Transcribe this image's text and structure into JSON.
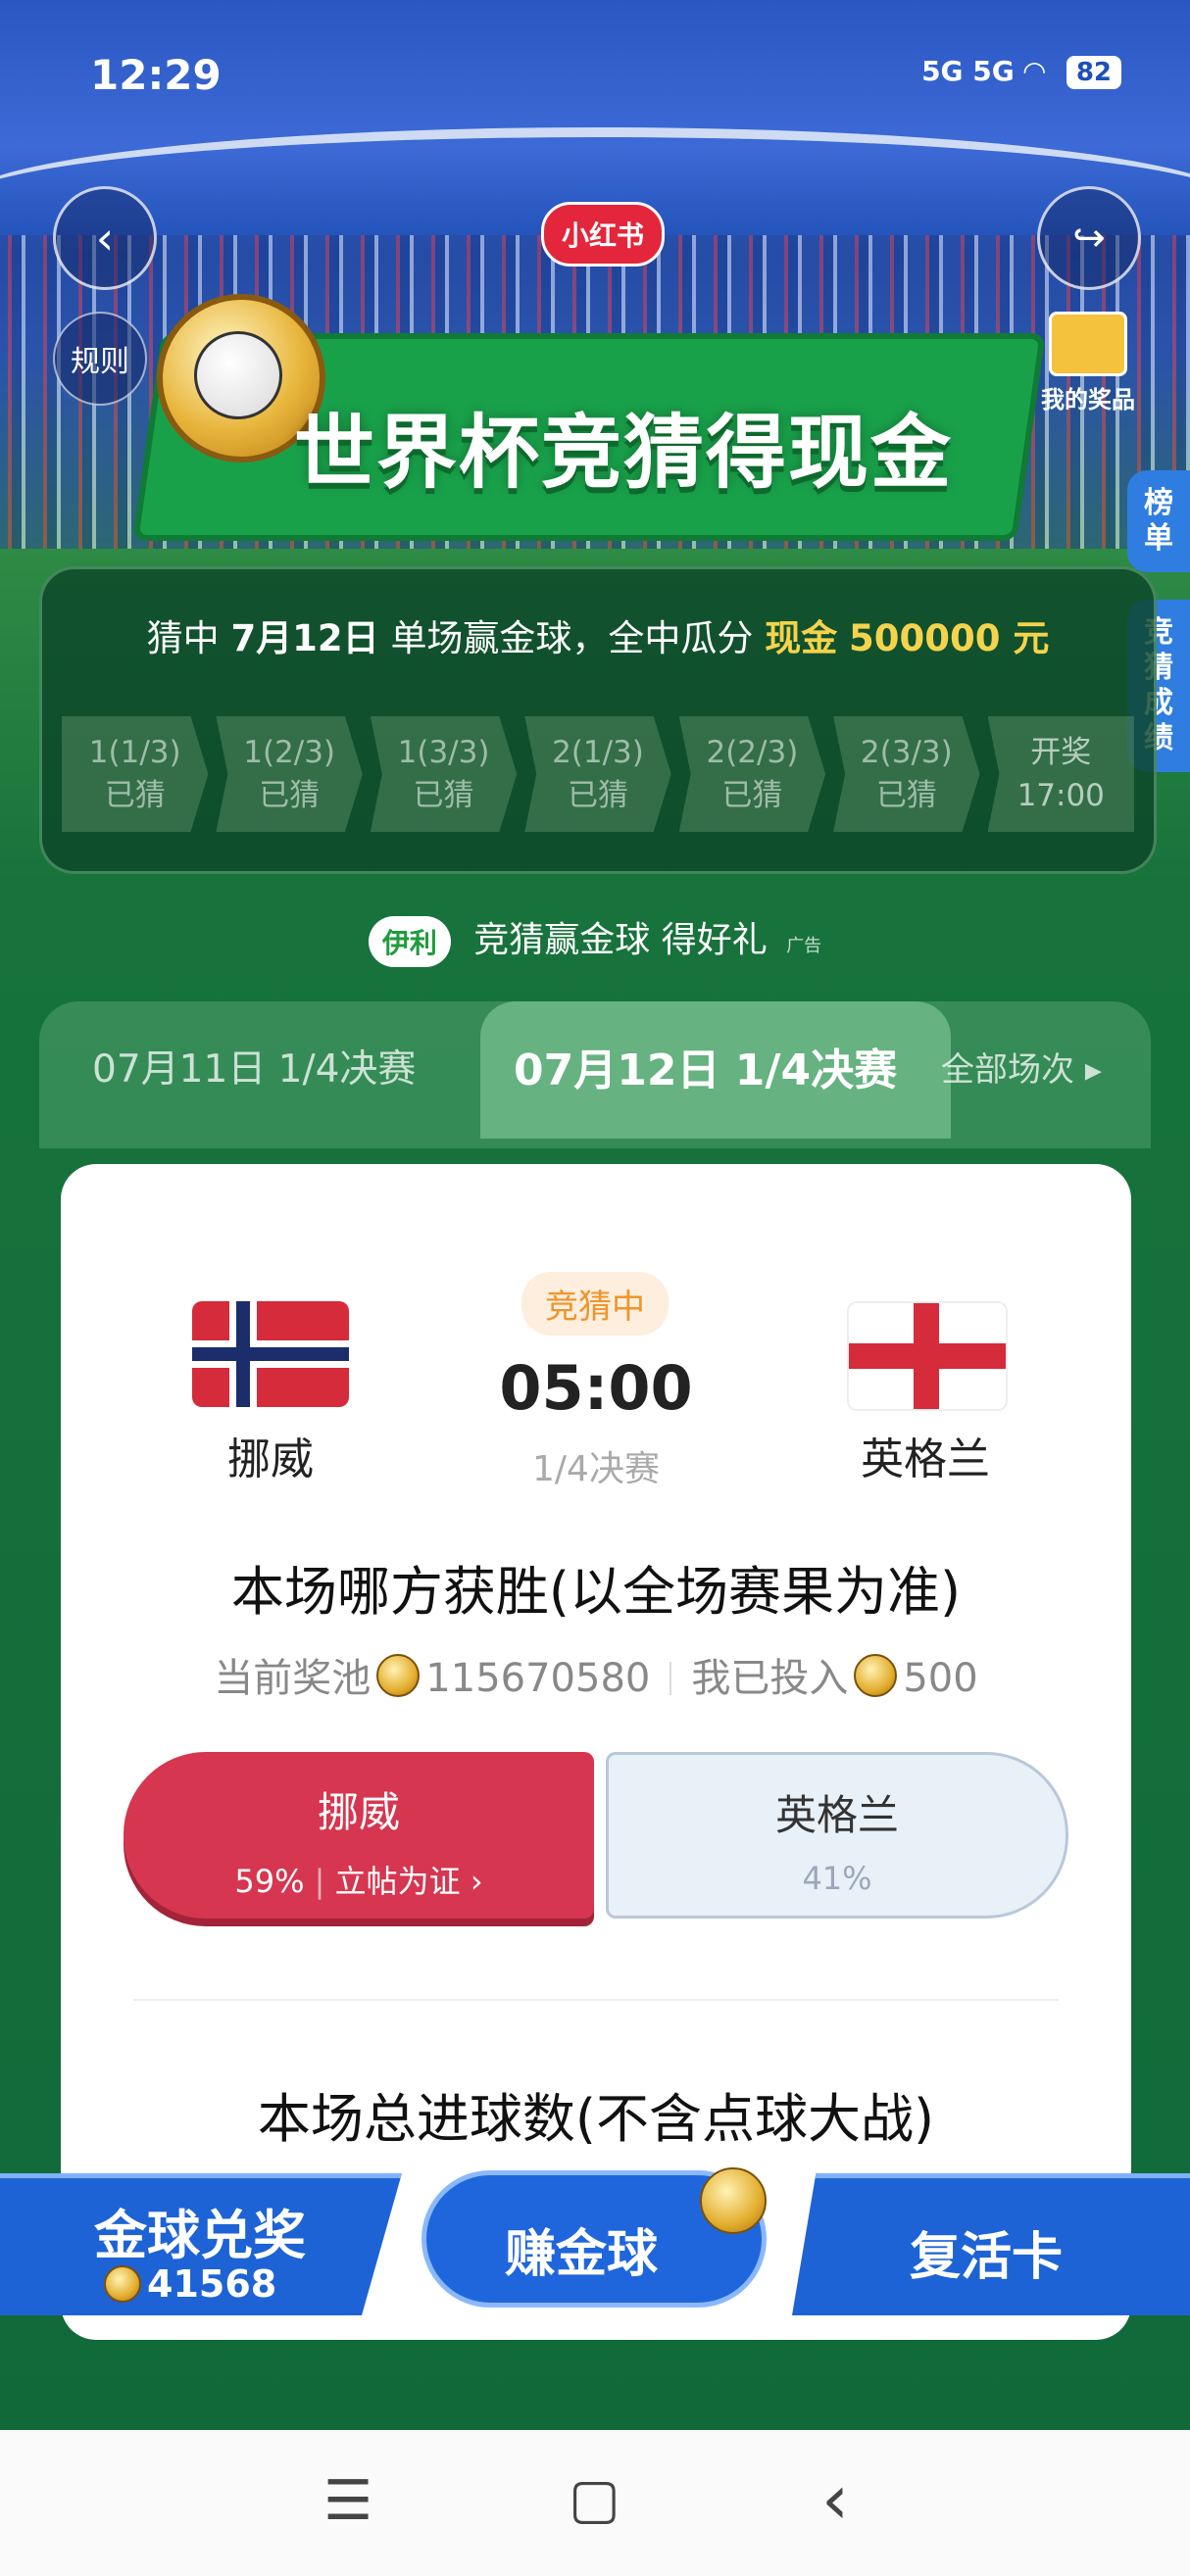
{
  "status": {
    "time": "12:29",
    "network": "5G 5G",
    "battery": "82"
  },
  "header": {
    "app_logo": "小红书",
    "title": "世界杯竞猜得现金",
    "rules": "规则",
    "my_prize": "我的奖品",
    "side_tabs": [
      "榜单",
      "竞猜成绩"
    ]
  },
  "guess_panel": {
    "line_prefix": "猜中",
    "date": "7月12日",
    "line_mid": "单场赢金球，全中瓜分",
    "cash_label": "现金",
    "cash_amount": "500000 元",
    "steps": [
      {
        "top": "1(1/3)",
        "bottom": "已猜"
      },
      {
        "top": "1(2/3)",
        "bottom": "已猜"
      },
      {
        "top": "1(3/3)",
        "bottom": "已猜"
      },
      {
        "top": "2(1/3)",
        "bottom": "已猜"
      },
      {
        "top": "2(2/3)",
        "bottom": "已猜"
      },
      {
        "top": "2(3/3)",
        "bottom": "已猜"
      },
      {
        "top": "开奖",
        "bottom": "17:00"
      }
    ]
  },
  "ad": {
    "brand": "伊利",
    "text": "竞猜赢金球 得好礼",
    "tag": "广告"
  },
  "tabs": {
    "prev": "07月11日 1/4决赛",
    "active": "07月12日 1/4决赛",
    "all": "全部场次"
  },
  "match": {
    "status": "竞猜中",
    "time": "05:00",
    "stage": "1/4决赛",
    "home": "挪威",
    "away": "英格兰",
    "question1": "本场哪方获胜(以全场赛果为准)",
    "pool_label": "当前奖池",
    "pool_value": "115670580",
    "invested_label": "我已投入",
    "invested_value": "500",
    "home_pct": "59%",
    "home_extra": "立帖为证",
    "away_pct": "41%",
    "question2": "本场总进球数(不含点球大战)"
  },
  "actions": {
    "redeem": "金球兑奖",
    "coins": "41568",
    "earn": "赚金球",
    "revive": "复活卡"
  },
  "colors": {
    "accent_green": "#19a14a",
    "home_red": "#d6364f",
    "action_blue": "#1d63d6",
    "gold": "#f5d34c"
  }
}
